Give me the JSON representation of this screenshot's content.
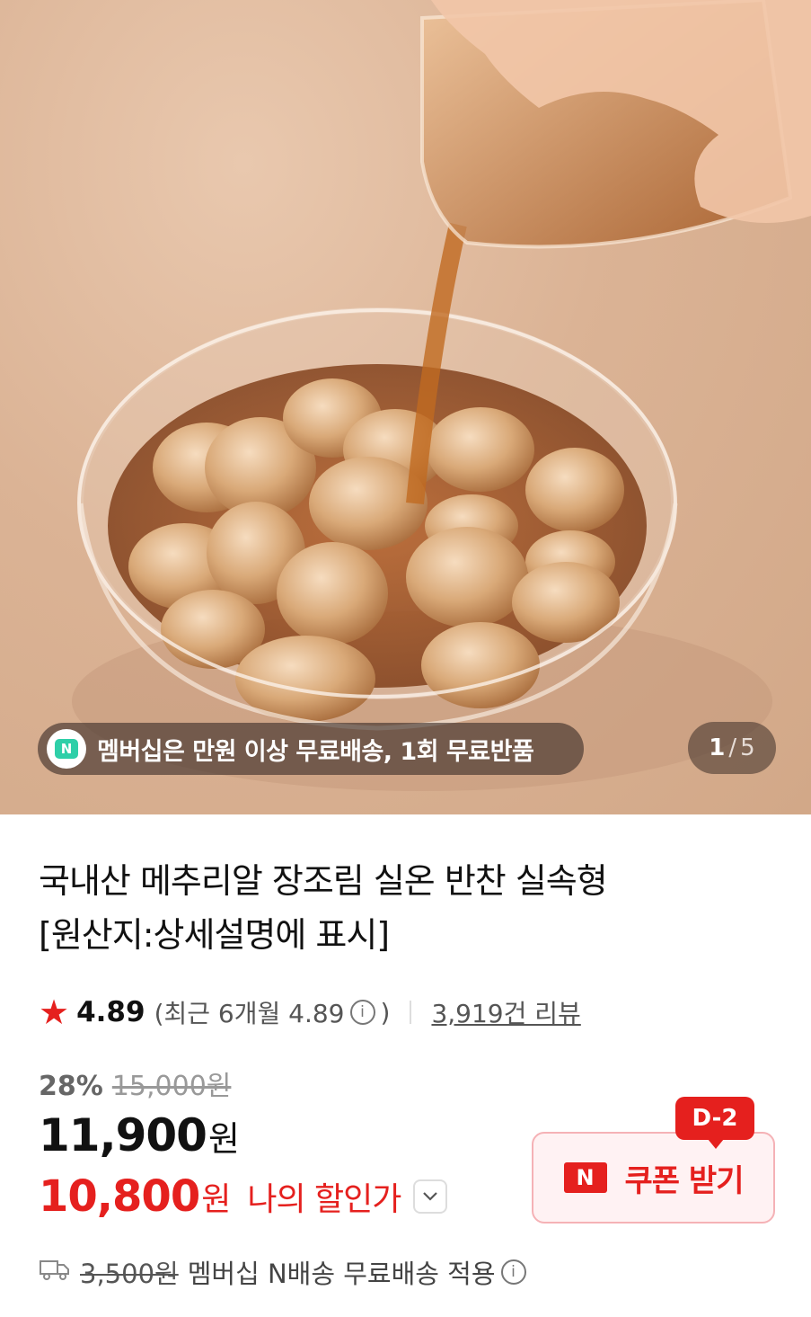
{
  "hero": {
    "image_alt": "quail eggs soy sauce bowl",
    "promo_banner": {
      "icon": "membership-n-icon",
      "icon_letter": "N",
      "text": "멤버십은 만원 이상 무료배송, 1회 무료반품"
    },
    "image_counter": {
      "current": "1",
      "separator": "/",
      "total": "5"
    }
  },
  "product": {
    "title_line1": "국내산 메추리알 장조림 실온 반찬 실속형",
    "title_line2": "[원산지:상세설명에 표시]",
    "rating": {
      "icon": "star-icon",
      "score": "4.89",
      "recent_label": "(최근 6개월 4.89",
      "recent_close": ")",
      "info_icon": "info-icon",
      "review_link": "3,919건 리뷰"
    },
    "price": {
      "discount_percent": "28%",
      "original_price": "15,000원",
      "sale_price": "11,900",
      "sale_currency": "원",
      "my_price": "10,800",
      "my_currency": "원",
      "my_label": "나의 할인가"
    },
    "coupon": {
      "badge": "D-2",
      "icon_letter": "N",
      "label": "쿠폰 받기"
    },
    "shipping": {
      "icon": "truck-icon",
      "original_fee": "3,500원",
      "text": "멤버십 N배송 무료배송 적용"
    }
  },
  "colors": {
    "accent_red": "#e5201e",
    "membership_green": "#2ecfa8"
  }
}
